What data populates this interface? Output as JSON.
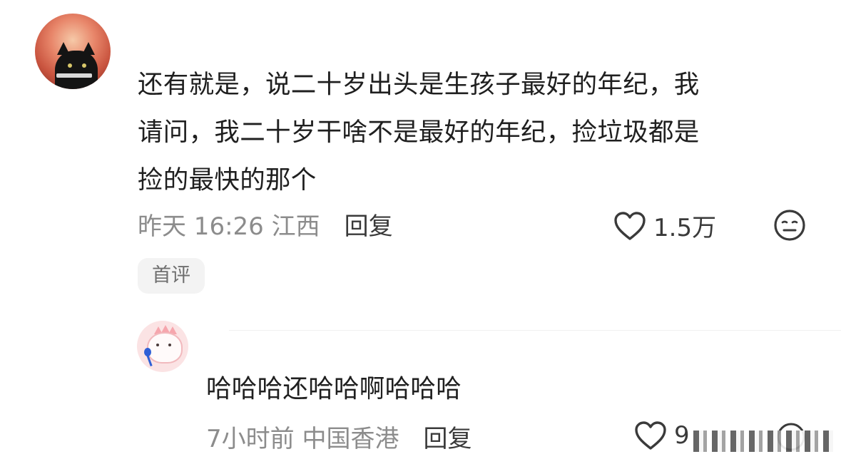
{
  "comment1": {
    "text": "还有就是，说二十岁出头是生孩子最好的年纪，我\n请问，我二十岁干啥不是最好的年纪，捡垃圾都是\n捡的最快的那个",
    "time_location": "昨天 16:26 江西",
    "reply_label": "回复",
    "like_count": "1.5万",
    "badge": "首评",
    "like_icon": "heart-outline-icon",
    "reaction_icon": "neutral-face-icon"
  },
  "comment2": {
    "text": "哈哈哈还哈哈啊哈哈哈",
    "time_location": "7小时前 中国香港",
    "reply_label": "回复",
    "like_count": "9",
    "like_icon": "heart-outline-icon"
  },
  "colors": {
    "text": "#1f1f1f",
    "meta": "#8c8c8c",
    "badge_bg": "#f3f3f3"
  }
}
